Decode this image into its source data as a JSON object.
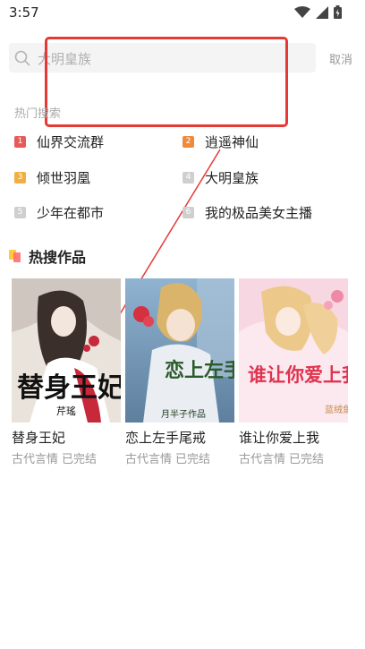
{
  "status_bar": {
    "time": "3:57"
  },
  "search": {
    "placeholder": "大明皇族",
    "cancel_label": "取消"
  },
  "hot_search": {
    "title": "热门搜索",
    "items": [
      {
        "rank": "1",
        "label": "仙界交流群",
        "color": "#e85a5a"
      },
      {
        "rank": "2",
        "label": "逍遥神仙",
        "color": "#ef8a3b"
      },
      {
        "rank": "3",
        "label": "倾世羽凰",
        "color": "#f0b040"
      },
      {
        "rank": "4",
        "label": "大明皇族",
        "color": "#cfcfcf"
      },
      {
        "rank": "5",
        "label": "少年在都市",
        "color": "#cfcfcf"
      },
      {
        "rank": "6",
        "label": "我的极品美女主播",
        "color": "#cfcfcf"
      }
    ]
  },
  "hot_works": {
    "title": "热搜作品",
    "books": [
      {
        "title": "替身王妃",
        "category": "古代言情",
        "status": "已完结",
        "cover_text": "替身王妃",
        "cover_author": "芹瑤"
      },
      {
        "title": "恋上左手尾戒",
        "category": "古代言情",
        "status": "已完结",
        "cover_text": "恋上左手尾戒",
        "cover_author": "月半子作品"
      },
      {
        "title": "谁让你爱上我",
        "category": "古代言情",
        "status": "已完结",
        "cover_text": "谁让你爱上我",
        "cover_author": "蓝绒鱼"
      }
    ]
  },
  "colors": {
    "accent_red": "#e53935",
    "muted": "#999999"
  }
}
